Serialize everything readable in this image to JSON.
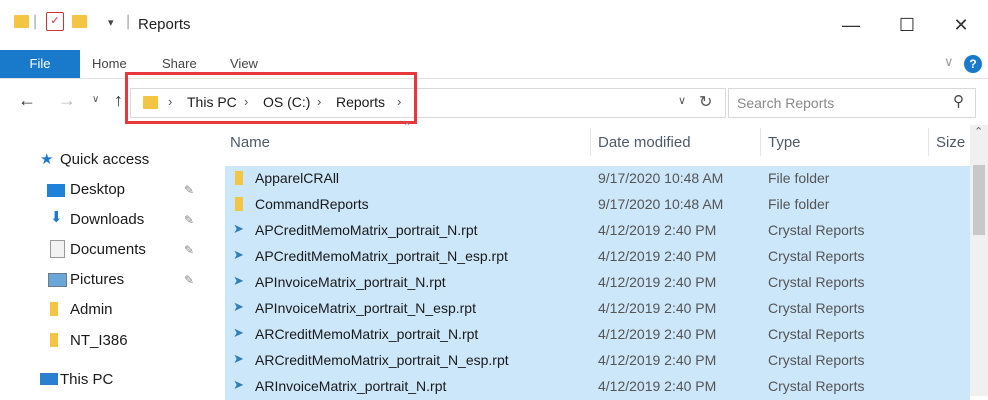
{
  "window": {
    "title": "Reports",
    "minimize": "—",
    "maximize": "☐",
    "close": "✕"
  },
  "ribbon": {
    "tabs": [
      "File",
      "Home",
      "Share",
      "View"
    ]
  },
  "address": {
    "crumbs": [
      "This PC",
      "OS (C:)",
      "Reports"
    ]
  },
  "search": {
    "placeholder": "Search Reports"
  },
  "nav": {
    "quick_access": "Quick access",
    "items": [
      "Desktop",
      "Downloads",
      "Documents",
      "Pictures",
      "Admin",
      "NT_I386"
    ],
    "this_pc": "This PC"
  },
  "columns": {
    "name": "Name",
    "date": "Date modified",
    "type": "Type",
    "size": "Size"
  },
  "files": [
    {
      "name": "ApparelCRAll",
      "date": "9/17/2020 10:48 AM",
      "type": "File folder",
      "icon": "folder-icon"
    },
    {
      "name": "CommandReports",
      "date": "9/17/2020 10:48 AM",
      "type": "File folder",
      "icon": "folder-icon"
    },
    {
      "name": "APCreditMemoMatrix_portrait_N.rpt",
      "date": "4/12/2019 2:40 PM",
      "type": "Crystal Reports",
      "icon": "crystal-report-icon"
    },
    {
      "name": "APCreditMemoMatrix_portrait_N_esp.rpt",
      "date": "4/12/2019 2:40 PM",
      "type": "Crystal Reports",
      "icon": "crystal-report-icon"
    },
    {
      "name": "APInvoiceMatrix_portrait_N.rpt",
      "date": "4/12/2019 2:40 PM",
      "type": "Crystal Reports",
      "icon": "crystal-report-icon"
    },
    {
      "name": "APInvoiceMatrix_portrait_N_esp.rpt",
      "date": "4/12/2019 2:40 PM",
      "type": "Crystal Reports",
      "icon": "crystal-report-icon"
    },
    {
      "name": "ARCreditMemoMatrix_portrait_N.rpt",
      "date": "4/12/2019 2:40 PM",
      "type": "Crystal Reports",
      "icon": "crystal-report-icon"
    },
    {
      "name": "ARCreditMemoMatrix_portrait_N_esp.rpt",
      "date": "4/12/2019 2:40 PM",
      "type": "Crystal Reports",
      "icon": "crystal-report-icon"
    },
    {
      "name": "ARInvoiceMatrix_portrait_N.rpt",
      "date": "4/12/2019 2:40 PM",
      "type": "Crystal Reports",
      "icon": "crystal-report-icon"
    }
  ],
  "colors": {
    "selection": "#cce6fa",
    "accent": "#1979ca",
    "highlight_box": "#e8383d"
  }
}
